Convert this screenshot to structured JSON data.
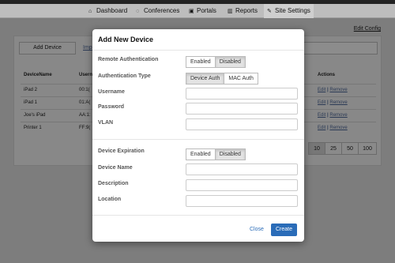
{
  "nav": {
    "items": [
      {
        "label": "Dashboard",
        "icon": "home-icon"
      },
      {
        "label": "Conferences",
        "icon": "chat-icon"
      },
      {
        "label": "Portals",
        "icon": "image-icon"
      },
      {
        "label": "Reports",
        "icon": "bar-chart-icon"
      },
      {
        "label": "Site Settings",
        "icon": "wrench-icon",
        "active": true
      }
    ]
  },
  "background": {
    "edit_config": "Edit Config",
    "add_device": "Add Device",
    "import_link": "Imp",
    "columns": [
      "DeviceName",
      "Usern",
      "Actions"
    ],
    "rows": [
      {
        "name": "iPad 2",
        "user": "00:1("
      },
      {
        "name": "iPad 1",
        "user": "01:A("
      },
      {
        "name": "Joe's iPad",
        "user": "AA:1:"
      },
      {
        "name": "Printer 1",
        "user": "FF:9("
      }
    ],
    "action_edit": "Edit",
    "action_sep": "|",
    "action_remove": "Remove",
    "pager": [
      "10",
      "25",
      "50",
      "100"
    ]
  },
  "modal": {
    "title": "Add New Device",
    "remote_auth": {
      "label": "Remote Authentication",
      "options": [
        "Enabled",
        "Disabled"
      ],
      "selected": "Disabled"
    },
    "auth_type": {
      "label": "Authentication Type",
      "options": [
        "Device Auth",
        "MAC Auth"
      ],
      "selected": "Device Auth"
    },
    "username": {
      "label": "Username",
      "value": ""
    },
    "password": {
      "label": "Password",
      "value": ""
    },
    "vlan": {
      "label": "VLAN",
      "value": ""
    },
    "expiration": {
      "label": "Device Expiration",
      "options": [
        "Enabled",
        "Disabled"
      ],
      "selected": "Disabled"
    },
    "device_name": {
      "label": "Device Name",
      "value": ""
    },
    "description": {
      "label": "Description",
      "value": ""
    },
    "location": {
      "label": "Location",
      "value": ""
    },
    "close_label": "Close",
    "create_label": "Create"
  },
  "colors": {
    "primary": "#2a6cb8",
    "overlay": "#7d7d7d"
  }
}
